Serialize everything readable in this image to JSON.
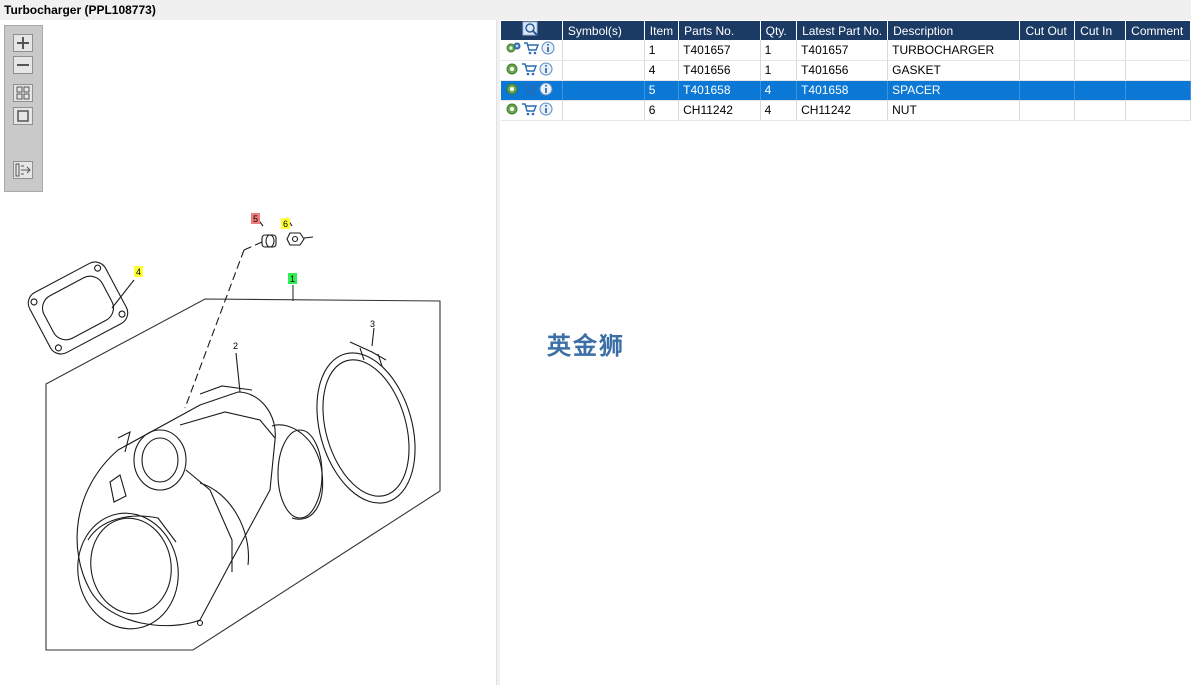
{
  "window": {
    "title": "Turbocharger (PPL108773)"
  },
  "toolbar": {
    "buttons": [
      {
        "name": "zoom-in-icon"
      },
      {
        "name": "zoom-out-icon"
      },
      {
        "name": "fit-all-icon"
      },
      {
        "name": "actual-size-icon"
      },
      {
        "name": "toggle-list-icon"
      }
    ]
  },
  "drawing": {
    "callouts": [
      {
        "label": "5",
        "color": "#f07b7b"
      },
      {
        "label": "6",
        "color": "#ffff33"
      },
      {
        "label": "4",
        "color": "#ffff33"
      },
      {
        "label": "1",
        "color": "#33ee55"
      },
      {
        "label": "3"
      },
      {
        "label": "2"
      }
    ]
  },
  "table": {
    "columns": [
      "",
      "Symbol(s)",
      "Item",
      "Parts No.",
      "Qty.",
      "Latest Part No.",
      "Description",
      "Cut Out",
      "Cut In",
      "Comment"
    ],
    "rows": [
      {
        "icons": [
          "gears-icon",
          "cart-icon",
          "info-icon"
        ],
        "symbols": "",
        "item": "1",
        "part": "T401657",
        "qty": "1",
        "latest": "T401657",
        "description": "TURBOCHARGER",
        "cut_out": "",
        "cut_in": "",
        "comment": "",
        "selected": false
      },
      {
        "icons": [
          "gear-icon",
          "cart-icon",
          "info-icon"
        ],
        "symbols": "",
        "item": "4",
        "part": "T401656",
        "qty": "1",
        "latest": "T401656",
        "description": "GASKET",
        "cut_out": "",
        "cut_in": "",
        "comment": "",
        "selected": false
      },
      {
        "icons": [
          "gear-icon",
          "cart-icon",
          "info-icon"
        ],
        "symbols": "",
        "item": "5",
        "part": "T401658",
        "qty": "4",
        "latest": "T401658",
        "description": "SPACER",
        "cut_out": "",
        "cut_in": "",
        "comment": "",
        "selected": true
      },
      {
        "icons": [
          "gear-icon",
          "cart-icon",
          "info-icon"
        ],
        "symbols": "",
        "item": "6",
        "part": "CH11242",
        "qty": "4",
        "latest": "CH11242",
        "description": "NUT",
        "cut_out": "",
        "cut_in": "",
        "comment": "",
        "selected": false
      }
    ]
  },
  "watermark": {
    "text": "英金狮"
  },
  "colors": {
    "header_bg": "#1b3a64",
    "selected_row": "#0a78d4",
    "watermark": "#3b6fa6"
  }
}
